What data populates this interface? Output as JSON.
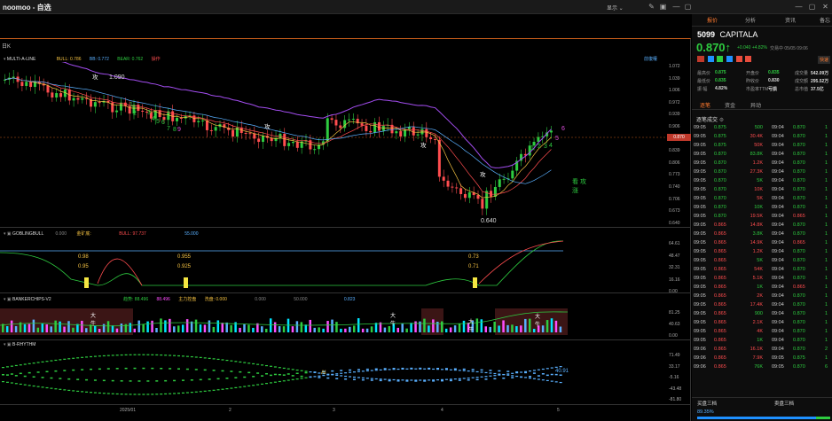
{
  "app": {
    "title": "noomoo - 自选",
    "show_label": "显示",
    "icons": [
      "pencil-icon",
      "layout-icon",
      "minimize-icon",
      "maximize-icon",
      "close-icon"
    ]
  },
  "chart": {
    "period": "日K",
    "rehab": "前復權",
    "main_indicator": {
      "name": "MULTI-A-LINE",
      "bull": "BULL: 0.786",
      "bb": "BB: 0.772",
      "bear": "BEAR: 0.762",
      "extra": "操作"
    },
    "price_axis": [
      "1.072",
      "1.039",
      "1.006",
      "0.972",
      "0.939",
      "0.906",
      "0.872",
      "0.839",
      "0.806",
      "0.773",
      "0.740",
      "0.706",
      "0.673",
      "0.640"
    ],
    "last_price_tag": "0.870",
    "annotations": [
      "攻",
      "攻",
      "攻",
      "攻",
      "1.090",
      "0.640",
      "1",
      "2",
      "3",
      "4",
      "5",
      "6",
      "7",
      "8",
      "9",
      "1",
      "2",
      "3",
      "4",
      "5",
      "6",
      "看涨",
      "攻"
    ],
    "gobling": {
      "name": "GOBLINGBULL",
      "v1": "0.000",
      "gold": "金矿底:",
      "bull": "BULL: 97.737",
      "v2": "55.000",
      "axis": [
        "64.61",
        "48.47",
        "32.31",
        "16.16",
        "0.00"
      ],
      "labels": [
        "0.98",
        "0.95",
        "0.955",
        "0.925",
        "0.73",
        "0.71"
      ]
    },
    "banker": {
      "name": "BANKERCHIPS-V2",
      "f1": "趋势: 88.496",
      "f2": "88.496",
      "f3": "主力控盘",
      "f4": "洗盘: 0.000",
      "f5": "0.000",
      "f6": "50.000",
      "f7": "0.823",
      "axis": [
        "81.25",
        "40.63",
        "0.00"
      ],
      "labels": [
        "大牛",
        "大牛",
        "大牛",
        "大牛"
      ]
    },
    "rhythm": {
      "name": "B-RHYTHM",
      "axis": [
        "71.49",
        "33.17",
        "-5.16",
        "-43.48",
        "-81.80"
      ],
      "last": "40.91",
      "mark": "AI"
    },
    "x_axis": [
      "2025/01",
      "2",
      "3",
      "4",
      "5"
    ]
  },
  "quote": {
    "tabs": [
      "报价",
      "分析",
      "资讯",
      "备忘"
    ],
    "code": "5099",
    "name": "CAPITALA",
    "price": "0.870",
    "change": "+0.040 +4.82%",
    "time": "交易中 05/05 09:06",
    "status": "快速",
    "stats": [
      [
        "最高价",
        "0.875",
        "开盘价",
        "0.835",
        "成交量",
        "542.09万"
      ],
      [
        "最低价",
        "0.835",
        "昨收价",
        "0.830",
        "成交额",
        "295.52万"
      ],
      [
        "振 幅",
        "4.82%",
        "市盈率TTM",
        "亏损",
        "总市值",
        "37.5亿"
      ]
    ],
    "subtabs": [
      "逐笔",
      "资金",
      "异动"
    ],
    "tick_title": "逐笔成交",
    "ticks": [
      [
        "09:05",
        "0.875",
        "500",
        "09:04",
        "0.870",
        "1"
      ],
      [
        "09:05",
        "0.875",
        "30.4K",
        "09:04",
        "0.870",
        "1"
      ],
      [
        "09:05",
        "0.875",
        "50K",
        "09:04",
        "0.870",
        "1"
      ],
      [
        "09:05",
        "0.870",
        "83.8K",
        "09:04",
        "0.870",
        "1"
      ],
      [
        "09:05",
        "0.870",
        "1.2K",
        "09:04",
        "0.870",
        "1"
      ],
      [
        "09:05",
        "0.870",
        "27.3K",
        "09:04",
        "0.870",
        "1"
      ],
      [
        "09:05",
        "0.870",
        "5K",
        "09:04",
        "0.870",
        "1"
      ],
      [
        "09:05",
        "0.870",
        "10K",
        "09:04",
        "0.870",
        "1"
      ],
      [
        "09:05",
        "0.870",
        "5K",
        "09:04",
        "0.870",
        "1"
      ],
      [
        "09:05",
        "0.870",
        "10K",
        "09:04",
        "0.870",
        "1"
      ],
      [
        "09:05",
        "0.870",
        "19.5K",
        "09:04",
        "0.865",
        "1"
      ],
      [
        "09:05",
        "0.865",
        "14.8K",
        "09:04",
        "0.870",
        "1"
      ],
      [
        "09:05",
        "0.865",
        "3.8K",
        "09:04",
        "0.870",
        "1"
      ],
      [
        "09:05",
        "0.865",
        "14.9K",
        "09:04",
        "0.865",
        "1"
      ],
      [
        "09:05",
        "0.865",
        "1.2K",
        "09:04",
        "0.870",
        "1"
      ],
      [
        "09:05",
        "0.865",
        "5K",
        "09:04",
        "0.870",
        "1"
      ],
      [
        "09:05",
        "0.865",
        "54K",
        "09:04",
        "0.870",
        "1"
      ],
      [
        "09:05",
        "0.865",
        "5.1K",
        "09:04",
        "0.870",
        "1"
      ],
      [
        "09:05",
        "0.865",
        "1K",
        "09:04",
        "0.865",
        "1"
      ],
      [
        "09:05",
        "0.865",
        "2K",
        "09:04",
        "0.870",
        "1"
      ],
      [
        "09:05",
        "0.865",
        "17.4K",
        "09:04",
        "0.870",
        "1"
      ],
      [
        "09:05",
        "0.865",
        "900",
        "09:04",
        "0.870",
        "1"
      ],
      [
        "09:05",
        "0.865",
        "2.1K",
        "09:04",
        "0.870",
        "1"
      ],
      [
        "09:05",
        "0.865",
        "4K",
        "09:04",
        "0.870",
        "1"
      ],
      [
        "09:05",
        "0.865",
        "1K",
        "09:04",
        "0.870",
        "1"
      ],
      [
        "09:06",
        "0.865",
        "16.1K",
        "09:04",
        "0.870",
        "2"
      ],
      [
        "09:06",
        "0.865",
        "7.9K",
        "09:05",
        "0.875",
        "1"
      ],
      [
        "09:06",
        "0.865",
        "76K",
        "09:05",
        "0.870",
        "6"
      ]
    ],
    "bottom": {
      "buy": "买盘三档",
      "sell": "卖盘三档",
      "pct": "89.35%"
    }
  }
}
